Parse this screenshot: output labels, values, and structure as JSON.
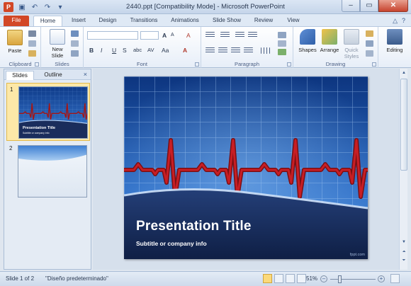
{
  "window": {
    "title": "2440.ppt [Compatibility Mode] - Microsoft PowerPoint",
    "app_icon_letter": "P",
    "controls": [
      "minimize",
      "maximize",
      "close"
    ]
  },
  "ribbon_tabs": [
    {
      "label": "File"
    },
    {
      "label": "Home"
    },
    {
      "label": "Insert"
    },
    {
      "label": "Design"
    },
    {
      "label": "Transitions"
    },
    {
      "label": "Animations"
    },
    {
      "label": "Slide Show"
    },
    {
      "label": "Review"
    },
    {
      "label": "View"
    }
  ],
  "ribbon": {
    "clipboard": {
      "label": "Clipboard",
      "paste": "Paste"
    },
    "slides": {
      "label": "Slides",
      "new_slide_line1": "New",
      "new_slide_line2": "Slide"
    },
    "font": {
      "label": "Font",
      "bold": "B",
      "italic": "I",
      "underline": "U",
      "strike": "S",
      "shadow": "abc",
      "spacing": "AV",
      "case": "Aa",
      "grow": "A",
      "shrink": "A",
      "clear": "A"
    },
    "paragraph": {
      "label": "Paragraph"
    },
    "drawing": {
      "label": "Drawing",
      "shapes": "Shapes",
      "arrange": "Arrange",
      "quick_styles_line1": "Quick",
      "quick_styles_line2": "Styles"
    },
    "editing": {
      "label": "Editing"
    }
  },
  "left_panel": {
    "tabs": [
      {
        "label": "Slides"
      },
      {
        "label": "Outline"
      }
    ],
    "close_glyph": "×",
    "thumbnails": [
      {
        "number": "1",
        "title": "Presentation Title",
        "subtitle": "Subtitle or company info"
      },
      {
        "number": "2"
      }
    ]
  },
  "slide": {
    "title": "Presentation Title",
    "subtitle": "Subtitle or company info",
    "watermark": "fppt.com"
  },
  "status_bar": {
    "slide_info": "Slide 1 of 2",
    "theme": "\"Diseño predeterminado\"",
    "zoom": "51%",
    "zoom_fraction": 0.51
  },
  "colors": {
    "file_tab": "#d24726",
    "slide_bg": "#1e4fa6",
    "heartbeat": "#a41616"
  }
}
